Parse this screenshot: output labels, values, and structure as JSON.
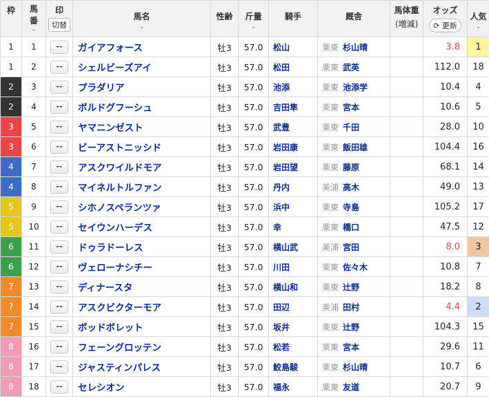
{
  "header": {
    "waku": "枠",
    "umaban_1": "馬",
    "umaban_2": "番",
    "mark": "印",
    "mark_toggle": "切替",
    "horse": "馬名",
    "seirei": "性齢",
    "kinryo": "斤量",
    "jockey": "騎手",
    "stable": "厩舎",
    "weight_1": "馬体重",
    "weight_2": "(増減)",
    "odds": "オッズ",
    "refresh": "更新",
    "ninki": "人気",
    "chevron": "⌄"
  },
  "mark_placeholder": "--",
  "waku_colors": {
    "1": {
      "bg": "#ffffff",
      "fg": "#222222"
    },
    "2": {
      "bg": "#333333",
      "fg": "#ffffff"
    },
    "3": {
      "bg": "#e8454b",
      "fg": "#ffffff"
    },
    "4": {
      "bg": "#3d6cc6",
      "fg": "#ffffff"
    },
    "5": {
      "bg": "#e8c41e",
      "fg": "#ffffff"
    },
    "6": {
      "bg": "#3aa04c",
      "fg": "#ffffff"
    },
    "7": {
      "bg": "#ef8a2a",
      "fg": "#ffffff"
    },
    "8": {
      "bg": "#f29ab6",
      "fg": "#ffffff"
    }
  },
  "ninki_highlights": {
    "1": "#fff69a",
    "2": "#cddcf7",
    "3": "#f0c5a0"
  },
  "rows": [
    {
      "waku": "1",
      "umaban": "1",
      "name": "ガイアフォース",
      "seirei": "牡3",
      "kinryo": "57.0",
      "jockey": "松山",
      "area": "栗東",
      "trainer": "杉山晴",
      "weight": "",
      "odds": "3.8",
      "hot": true,
      "ninki": "1"
    },
    {
      "waku": "1",
      "umaban": "2",
      "name": "シェルビーズアイ",
      "seirei": "牡3",
      "kinryo": "57.0",
      "jockey": "松田",
      "area": "栗東",
      "trainer": "武英",
      "weight": "",
      "odds": "112.0",
      "hot": false,
      "ninki": "18"
    },
    {
      "waku": "2",
      "umaban": "3",
      "name": "プラダリア",
      "seirei": "牡3",
      "kinryo": "57.0",
      "jockey": "池添",
      "area": "栗東",
      "trainer": "池添学",
      "weight": "",
      "odds": "10.4",
      "hot": false,
      "ninki": "4"
    },
    {
      "waku": "2",
      "umaban": "4",
      "name": "ボルドグフーシュ",
      "seirei": "牡3",
      "kinryo": "57.0",
      "jockey": "吉田隼",
      "area": "栗東",
      "trainer": "宮本",
      "weight": "",
      "odds": "10.6",
      "hot": false,
      "ninki": "5"
    },
    {
      "waku": "3",
      "umaban": "5",
      "name": "ヤマニンゼスト",
      "seirei": "牡3",
      "kinryo": "57.0",
      "jockey": "武豊",
      "area": "栗東",
      "trainer": "千田",
      "weight": "",
      "odds": "28.0",
      "hot": false,
      "ninki": "10"
    },
    {
      "waku": "3",
      "umaban": "6",
      "name": "ビーアストニッシド",
      "seirei": "牡3",
      "kinryo": "57.0",
      "jockey": "岩田康",
      "area": "栗東",
      "trainer": "飯田雄",
      "weight": "",
      "odds": "104.4",
      "hot": false,
      "ninki": "16"
    },
    {
      "waku": "4",
      "umaban": "7",
      "name": "アスクワイルドモア",
      "seirei": "牡3",
      "kinryo": "57.0",
      "jockey": "岩田望",
      "area": "栗東",
      "trainer": "藤原",
      "weight": "",
      "odds": "68.1",
      "hot": false,
      "ninki": "14"
    },
    {
      "waku": "4",
      "umaban": "8",
      "name": "マイネルトルファン",
      "seirei": "牡3",
      "kinryo": "57.0",
      "jockey": "丹内",
      "area": "美浦",
      "trainer": "高木",
      "weight": "",
      "odds": "49.0",
      "hot": false,
      "ninki": "13"
    },
    {
      "waku": "5",
      "umaban": "9",
      "name": "シホノスペランツァ",
      "seirei": "牡3",
      "kinryo": "57.0",
      "jockey": "浜中",
      "area": "栗東",
      "trainer": "寺島",
      "weight": "",
      "odds": "105.2",
      "hot": false,
      "ninki": "17"
    },
    {
      "waku": "5",
      "umaban": "10",
      "name": "セイウンハーデス",
      "seirei": "牡3",
      "kinryo": "57.0",
      "jockey": "幸",
      "area": "栗東",
      "trainer": "橋口",
      "weight": "",
      "odds": "47.5",
      "hot": false,
      "ninki": "12"
    },
    {
      "waku": "6",
      "umaban": "11",
      "name": "ドゥラドーレス",
      "seirei": "牡3",
      "kinryo": "57.0",
      "jockey": "横山武",
      "area": "美浦",
      "trainer": "宮田",
      "weight": "",
      "odds": "8.0",
      "hot": true,
      "ninki": "3"
    },
    {
      "waku": "6",
      "umaban": "12",
      "name": "ヴェローナシチー",
      "seirei": "牡3",
      "kinryo": "57.0",
      "jockey": "川田",
      "area": "栗東",
      "trainer": "佐々木",
      "weight": "",
      "odds": "10.8",
      "hot": false,
      "ninki": "7"
    },
    {
      "waku": "7",
      "umaban": "13",
      "name": "ディナースタ",
      "seirei": "牡3",
      "kinryo": "57.0",
      "jockey": "横山和",
      "area": "栗東",
      "trainer": "辻野",
      "weight": "",
      "odds": "18.2",
      "hot": false,
      "ninki": "8"
    },
    {
      "waku": "7",
      "umaban": "14",
      "name": "アスクビクターモア",
      "seirei": "牡3",
      "kinryo": "57.0",
      "jockey": "田辺",
      "area": "美浦",
      "trainer": "田村",
      "weight": "",
      "odds": "4.4",
      "hot": true,
      "ninki": "2"
    },
    {
      "waku": "7",
      "umaban": "15",
      "name": "ボッドボレット",
      "seirei": "牡3",
      "kinryo": "57.0",
      "jockey": "坂井",
      "area": "栗東",
      "trainer": "辻野",
      "weight": "",
      "odds": "104.3",
      "hot": false,
      "ninki": "15"
    },
    {
      "waku": "8",
      "umaban": "16",
      "name": "フェーングロッテン",
      "seirei": "牡3",
      "kinryo": "57.0",
      "jockey": "松若",
      "area": "栗東",
      "trainer": "宮本",
      "weight": "",
      "odds": "29.6",
      "hot": false,
      "ninki": "11"
    },
    {
      "waku": "8",
      "umaban": "17",
      "name": "ジャスティンパレス",
      "seirei": "牡3",
      "kinryo": "57.0",
      "jockey": "鮫島駿",
      "area": "栗東",
      "trainer": "杉山晴",
      "weight": "",
      "odds": "10.7",
      "hot": false,
      "ninki": "6"
    },
    {
      "waku": "8",
      "umaban": "18",
      "name": "セレシオン",
      "seirei": "牡3",
      "kinryo": "57.0",
      "jockey": "福永",
      "area": "栗東",
      "trainer": "友道",
      "weight": "",
      "odds": "20.7",
      "hot": false,
      "ninki": "9"
    }
  ]
}
